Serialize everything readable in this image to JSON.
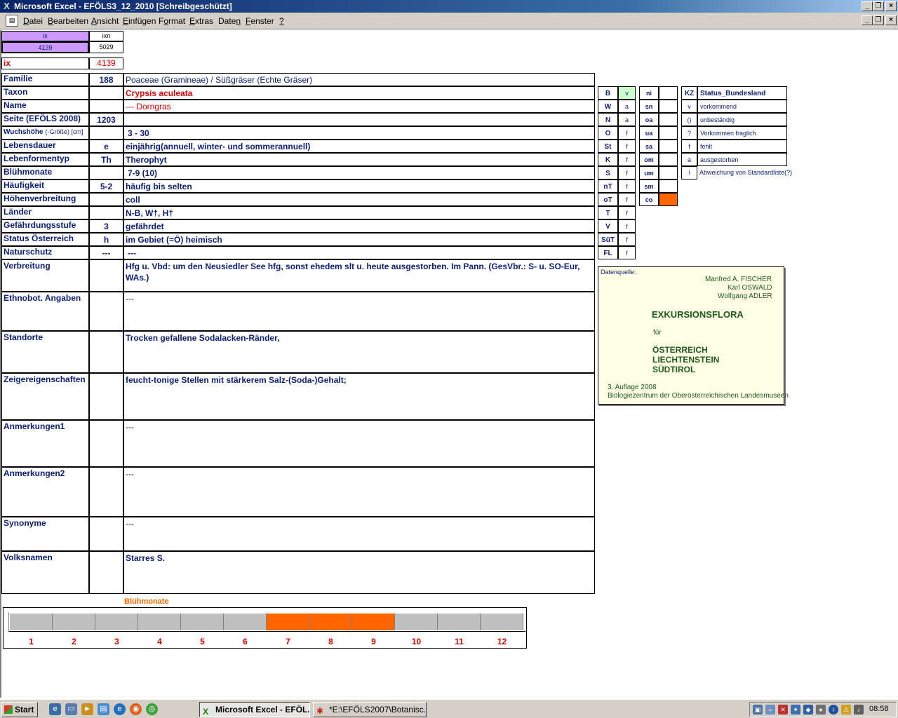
{
  "window": {
    "title": "Microsoft Excel - EFÖLS3_12_2010  [Schreibgeschützt]"
  },
  "menu": {
    "items": [
      {
        "pre": "",
        "mn": "D",
        "post": "atei"
      },
      {
        "pre": "",
        "mn": "B",
        "post": "earbeiten"
      },
      {
        "pre": "",
        "mn": "A",
        "post": "nsicht"
      },
      {
        "pre": "",
        "mn": "E",
        "post": "infügen"
      },
      {
        "pre": "F",
        "mn": "o",
        "post": "rmat"
      },
      {
        "pre": "",
        "mn": "E",
        "post": "xtras"
      },
      {
        "pre": "Date",
        "mn": "n",
        "post": ""
      },
      {
        "pre": "",
        "mn": "F",
        "post": "enster"
      },
      {
        "pre": "",
        "mn": "?",
        "post": ""
      }
    ]
  },
  "index": {
    "ix_header": "ix",
    "ixn_header": "ixn",
    "ix_value": "4139",
    "ixn_value": "5029",
    "ix_label": "ix",
    "ix_big": "4139"
  },
  "record": {
    "rows": [
      {
        "label": "Familie",
        "code": "188",
        "value": "Poaceae (Gramineae)  /  Süßgräser (Echte Gräser)"
      },
      {
        "label": "Taxon",
        "code": "",
        "value": "Crypsis aculeata"
      },
      {
        "label": "Name",
        "code": "",
        "value": "--- Dorngras"
      },
      {
        "label": "Seite (EFÖLS 2008)",
        "code": "1203",
        "value": ""
      },
      {
        "label": "Wuchshöhe",
        "label_suffix": "(-Größe) [cm]",
        "code": "",
        "value": "3 - 30"
      },
      {
        "label": "Lebensdauer",
        "code": "e",
        "value": "einjährig(annuell, winter- und sommerannuell)"
      },
      {
        "label": "Lebenformentyp",
        "code": "Th",
        "value": "Therophyt"
      },
      {
        "label": "Blühmonate",
        "code": "",
        "value": "7-9 (10)"
      },
      {
        "label": "Häufigkeit",
        "code": "5-2",
        "value": "häufig bis selten"
      },
      {
        "label": "Höhenverbreitung",
        "code": "",
        "value": "coll"
      },
      {
        "label": "Länder",
        "code": "",
        "value": "N-B, W†, H†"
      },
      {
        "label": "Gefährdungsstufe",
        "code": "3",
        "value": "gefährdet"
      },
      {
        "label": "Status Österreich",
        "code": "h",
        "value": "im Gebiet (=Ö) heimisch"
      },
      {
        "label": "Naturschutz",
        "code": "---",
        "value": "---"
      }
    ],
    "tall_rows": [
      {
        "label": "Verbreitung",
        "value": "Hfg u. Vbd: um den Neusiedler See hfg, sonst ehedem slt u. heute ausgestorben. Im Pann. (GesVbr.: S- u. SO-Eur, WAs.)"
      },
      {
        "label": "Ethnobot. Angaben",
        "value": "---"
      },
      {
        "label": "Standorte",
        "value": "Trocken gefallene Sodalacken-Ränder,"
      },
      {
        "label": "Zeigereigenschaften",
        "value": "feucht-tonige Stellen mit stärkerem Salz-(Soda-)Gehalt;"
      },
      {
        "label": "Anmerkungen1",
        "value": "---"
      },
      {
        "label": "Anmerkungen2",
        "value": "---"
      },
      {
        "label": "Synonyme",
        "value": "---"
      },
      {
        "label": "Volksnamen",
        "value": "Starres S."
      }
    ]
  },
  "status_states": [
    {
      "code": "B",
      "value": "v"
    },
    {
      "code": "W",
      "value": "a"
    },
    {
      "code": "N",
      "value": "a"
    },
    {
      "code": "O",
      "value": "f"
    },
    {
      "code": "St",
      "value": "f"
    },
    {
      "code": "K",
      "value": "f"
    },
    {
      "code": "S",
      "value": "f"
    },
    {
      "code": "nT",
      "value": "f"
    },
    {
      "code": "oT",
      "value": "f"
    },
    {
      "code": "T",
      "value": "f"
    },
    {
      "code": "V",
      "value": "f"
    },
    {
      "code": "SüT",
      "value": "f"
    },
    {
      "code": "FL",
      "value": "f"
    }
  ],
  "altitude_codes": [
    {
      "code": "ni",
      "value": ""
    },
    {
      "code": "sn",
      "value": ""
    },
    {
      "code": "oa",
      "value": ""
    },
    {
      "code": "ua",
      "value": ""
    },
    {
      "code": "sa",
      "value": ""
    },
    {
      "code": "om",
      "value": ""
    },
    {
      "code": "um",
      "value": ""
    },
    {
      "code": "sm",
      "value": ""
    },
    {
      "code": "co",
      "value": "c"
    }
  ],
  "legend": {
    "header_code": "KZ",
    "header_label": "Status_Bundesland",
    "items": [
      {
        "code": "v",
        "label": "vorkommend"
      },
      {
        "code": "()",
        "label": "unbeständig"
      },
      {
        "code": "?",
        "label": "Vorkommen fraglich"
      },
      {
        "code": "f",
        "label": "fehlt"
      },
      {
        "code": "a",
        "label": "ausgestorben"
      },
      {
        "code": "!",
        "label": "Abweichung von Standardliste(?)"
      }
    ]
  },
  "source": {
    "label": "Datenquelle:",
    "author1": "Manfred A. FISCHER",
    "author2": "Karl OSWALD",
    "author3": "Wolfgang ADLER",
    "title": "EXKURSIONSFLORA",
    "fuer": "für",
    "country1": "ÖSTERREICH",
    "country2": "LIECHTENSTEIN",
    "country3": "SÜDTIROL",
    "edition": "3. Auflage 2008",
    "publisher": "Biologiezentrum der Oberösterreichischen Landesmuseen"
  },
  "bloom_chart": {
    "title": "Blühmonate",
    "months": [
      "1",
      "2",
      "3",
      "4",
      "5",
      "6",
      "7",
      "8",
      "9",
      "10",
      "11",
      "12"
    ],
    "active": [
      false,
      false,
      false,
      false,
      false,
      false,
      true,
      true,
      true,
      false,
      false,
      false
    ],
    "active_color": "#ff6600",
    "inactive_color": "#c0c0c0"
  },
  "taskbar": {
    "start": "Start",
    "task1": "Microsoft Excel - EFÖL...",
    "task2": "*E:\\EFÖLS2007\\Botanisc...",
    "clock": "08:58"
  }
}
